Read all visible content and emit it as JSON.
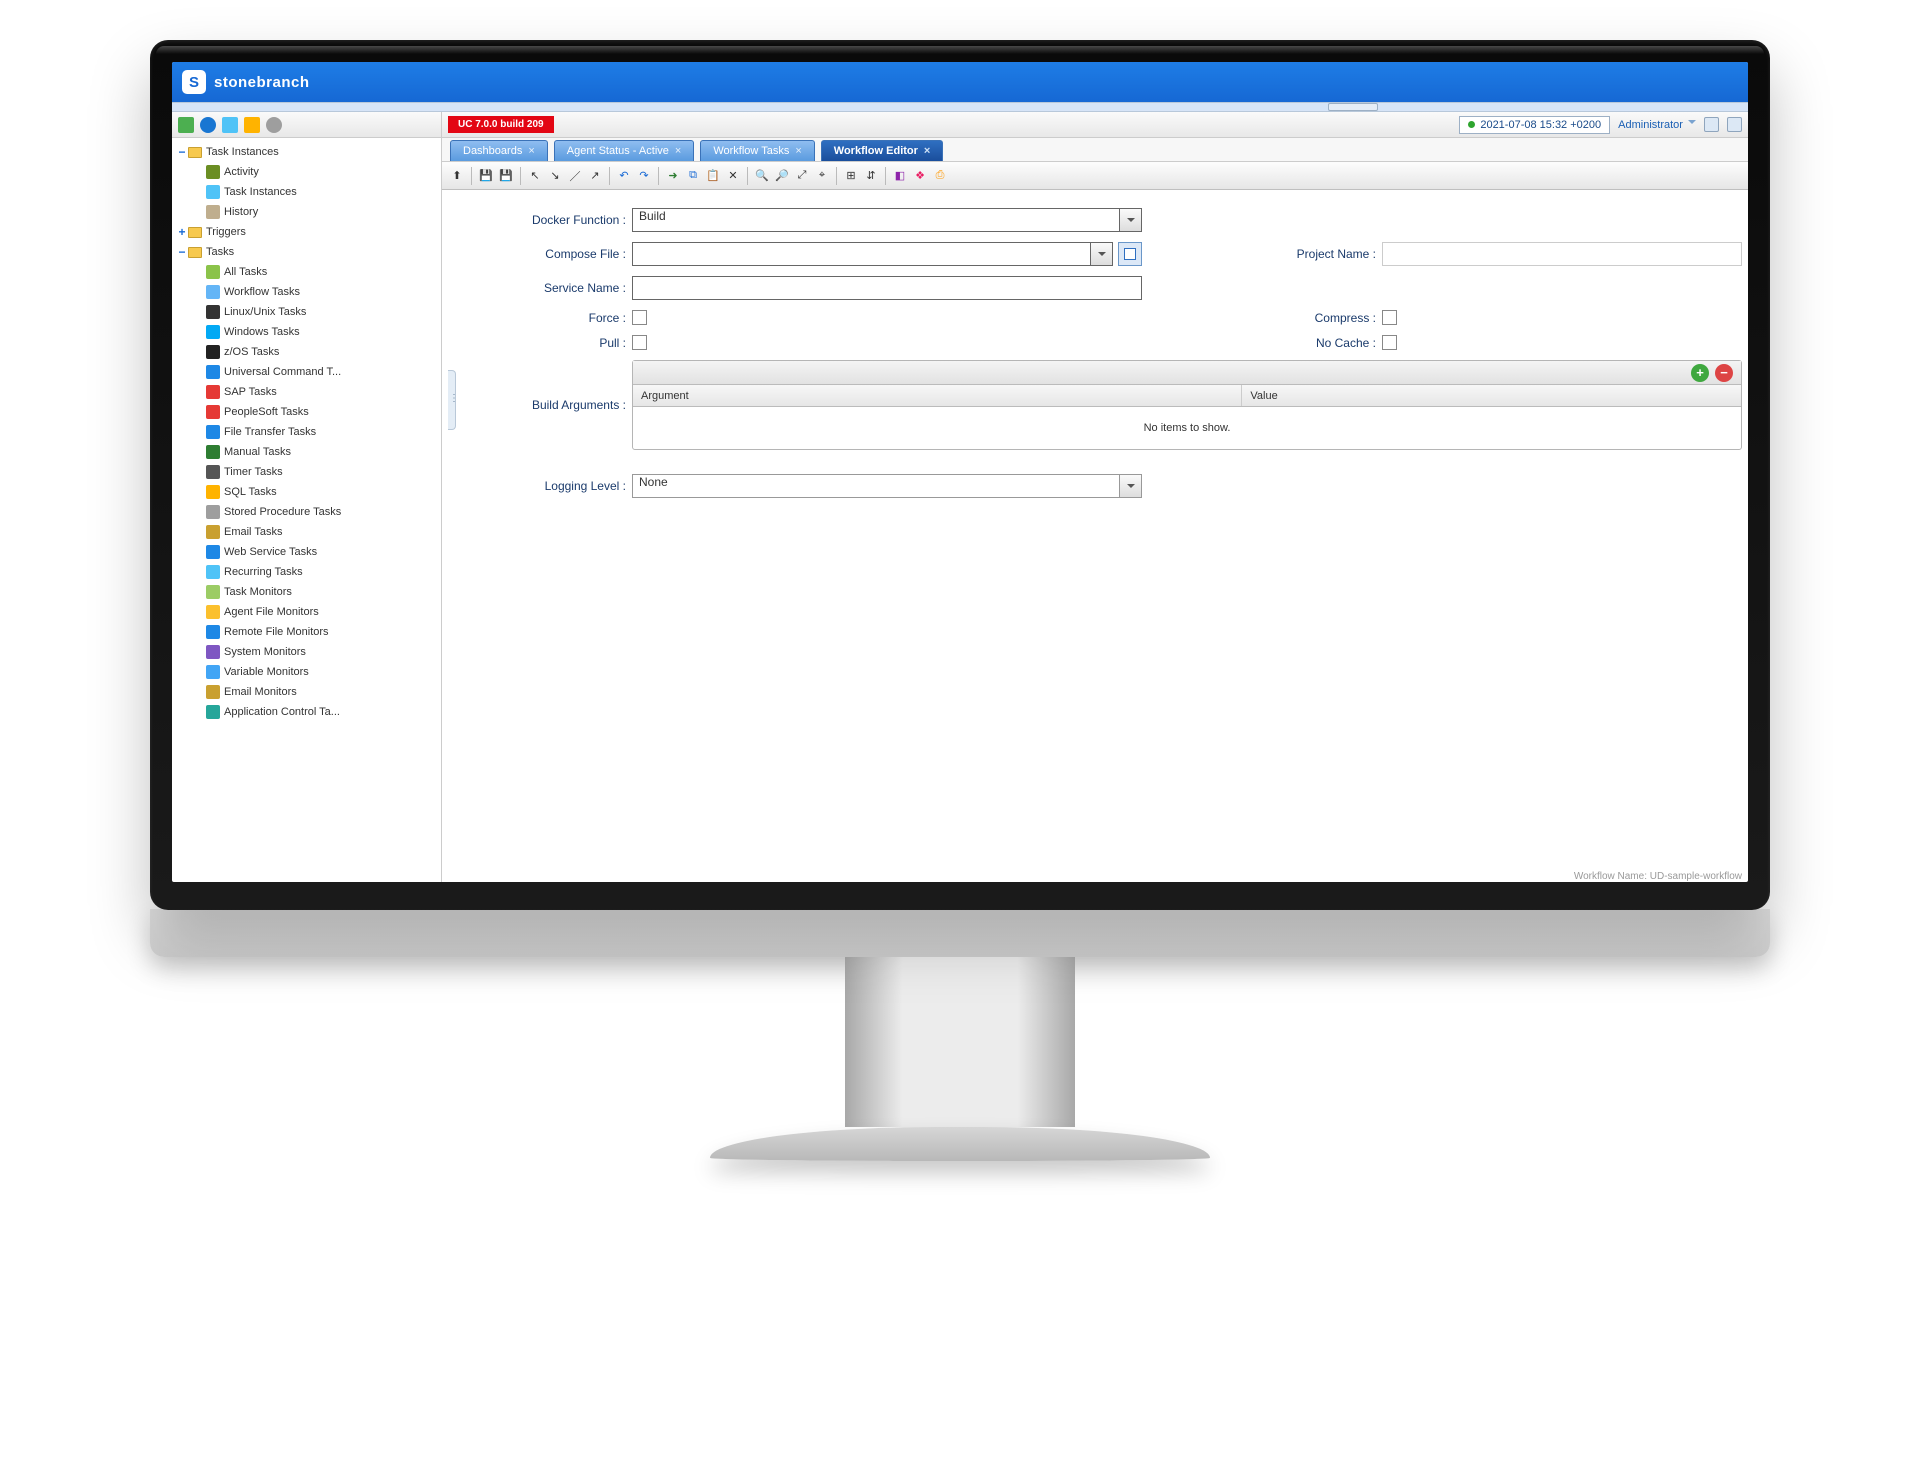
{
  "brand": "stonebranch",
  "build_badge": "UC 7.0.0 build 209",
  "timestamp": "2021-07-08 15:32 +0200",
  "user_menu": "Administrator",
  "tabs": [
    {
      "label": "Dashboards",
      "active": false
    },
    {
      "label": "Agent Status - Active",
      "active": false
    },
    {
      "label": "Workflow Tasks",
      "active": false
    },
    {
      "label": "Workflow Editor",
      "active": true
    }
  ],
  "tree": {
    "task_instances": {
      "label": "Task Instances",
      "children": [
        {
          "label": "Activity",
          "color": "#6b8e23"
        },
        {
          "label": "Task Instances",
          "color": "#4fc3f7"
        },
        {
          "label": "History",
          "color": "#bfae8e"
        }
      ]
    },
    "triggers": {
      "label": "Triggers"
    },
    "tasks": {
      "label": "Tasks",
      "children": [
        {
          "label": "All Tasks",
          "color": "#8bc34a"
        },
        {
          "label": "Workflow Tasks",
          "color": "#64b5f6"
        },
        {
          "label": "Linux/Unix Tasks",
          "color": "#333"
        },
        {
          "label": "Windows Tasks",
          "color": "#03a9f4"
        },
        {
          "label": "z/OS Tasks",
          "color": "#222"
        },
        {
          "label": "Universal Command T...",
          "color": "#1e88e5"
        },
        {
          "label": "SAP Tasks",
          "color": "#e53935"
        },
        {
          "label": "PeopleSoft Tasks",
          "color": "#e53935"
        },
        {
          "label": "File Transfer Tasks",
          "color": "#1e88e5"
        },
        {
          "label": "Manual Tasks",
          "color": "#2e7d32"
        },
        {
          "label": "Timer Tasks",
          "color": "#555"
        },
        {
          "label": "SQL Tasks",
          "color": "#ffb300"
        },
        {
          "label": "Stored Procedure Tasks",
          "color": "#9e9e9e"
        },
        {
          "label": "Email Tasks",
          "color": "#c9a030"
        },
        {
          "label": "Web Service Tasks",
          "color": "#1e88e5"
        },
        {
          "label": "Recurring Tasks",
          "color": "#4fc3f7"
        },
        {
          "label": "Task Monitors",
          "color": "#9ccc65"
        },
        {
          "label": "Agent File Monitors",
          "color": "#fbc02d"
        },
        {
          "label": "Remote File Monitors",
          "color": "#1e88e5"
        },
        {
          "label": "System Monitors",
          "color": "#7e57c2"
        },
        {
          "label": "Variable Monitors",
          "color": "#42a5f5"
        },
        {
          "label": "Email Monitors",
          "color": "#c9a030"
        },
        {
          "label": "Application Control Ta...",
          "color": "#26a69a"
        }
      ]
    }
  },
  "form": {
    "docker_function_label": "Docker Function :",
    "docker_function_value": "Build",
    "compose_file_label": "Compose File :",
    "compose_file_value": "",
    "service_name_label": "Service Name :",
    "service_name_value": "",
    "project_name_label": "Project Name :",
    "project_name_value": "",
    "force_label": "Force :",
    "pull_label": "Pull :",
    "compress_label": "Compress :",
    "no_cache_label": "No Cache :",
    "build_args_label": "Build Arguments :",
    "args_col_argument": "Argument",
    "args_col_value": "Value",
    "args_empty": "No items to show.",
    "logging_label": "Logging Level :",
    "logging_value": "None"
  },
  "footer_text": "Workflow Name: UD-sample-workflow"
}
